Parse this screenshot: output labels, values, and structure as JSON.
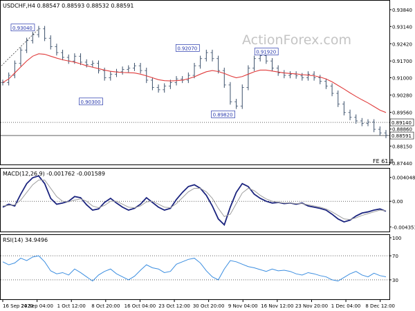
{
  "chart_data": {
    "type": "line",
    "watermark": "ActionForex.com",
    "price_panel": {
      "title": "USDCHF,H4  0.88547 0.88593 0.88532 0.88591",
      "y_ticks": [
        "0.93840",
        "0.93140",
        "0.92420",
        "0.91700",
        "0.91000",
        "0.90280",
        "0.89560",
        "0.88860",
        "0.88150",
        "0.87440"
      ],
      "ylim": [
        0.8744,
        0.9384
      ],
      "hlines": [
        {
          "value": 0.8914,
          "label": "0.89140",
          "style": "dotted"
        },
        {
          "value": 0.88591,
          "label": "0.88591",
          "style": "solid"
        }
      ],
      "annotations": [
        {
          "text": "0.93040",
          "x": "22 Sep",
          "y": 0.9304
        },
        {
          "text": "0.90300",
          "x": "16 Oct",
          "y": 0.903
        },
        {
          "text": "0.92070",
          "x": "30 Oct",
          "y": 0.9207
        },
        {
          "text": "0.89820",
          "x": "6 Nov",
          "y": 0.8982
        },
        {
          "text": "0.91920",
          "x": "10 Nov",
          "y": 0.9192
        }
      ],
      "fe_label": "FE 61.8",
      "series": [
        {
          "name": "Price",
          "color": "#3a4f6a",
          "style": "bars",
          "values": [
            0.908,
            0.911,
            0.916,
            0.9215,
            0.9255,
            0.928,
            0.9304,
            0.9265,
            0.923,
            0.9205,
            0.9185,
            0.917,
            0.919,
            0.9165,
            0.9155,
            0.916,
            0.913,
            0.91,
            0.9115,
            0.9125,
            0.9135,
            0.914,
            0.915,
            0.913,
            0.909,
            0.906,
            0.905,
            0.9065,
            0.908,
            0.9095,
            0.909,
            0.911,
            0.915,
            0.918,
            0.9205,
            0.918,
            0.913,
            0.907,
            0.9,
            0.8982,
            0.906,
            0.914,
            0.918,
            0.9192,
            0.917,
            0.914,
            0.912,
            0.911,
            0.9115,
            0.9108,
            0.91,
            0.9115,
            0.91,
            0.9085,
            0.9065,
            0.9035,
            0.899,
            0.8955,
            0.8935,
            0.892,
            0.891,
            0.8915,
            0.8885,
            0.887,
            0.886
          ]
        },
        {
          "name": "MA",
          "color": "#e03a3a",
          "style": "line",
          "values": [
            0.908,
            0.9095,
            0.912,
            0.9145,
            0.917,
            0.919,
            0.92,
            0.9198,
            0.919,
            0.9182,
            0.9175,
            0.917,
            0.9165,
            0.9158,
            0.915,
            0.9144,
            0.9138,
            0.9132,
            0.9127,
            0.9124,
            0.9122,
            0.9121,
            0.912,
            0.9115,
            0.9108,
            0.91,
            0.9092,
            0.9088,
            0.9087,
            0.9088,
            0.909,
            0.9096,
            0.9104,
            0.9115,
            0.9125,
            0.913,
            0.9126,
            0.9118,
            0.9108,
            0.91,
            0.9105,
            0.9115,
            0.9125,
            0.9132,
            0.9132,
            0.9128,
            0.9124,
            0.912,
            0.9118,
            0.9116,
            0.9113,
            0.9111,
            0.9108,
            0.9103,
            0.9095,
            0.9083,
            0.9068,
            0.9053,
            0.9037,
            0.9022,
            0.9008,
            0.8995,
            0.898,
            0.8965,
            0.8955
          ]
        }
      ]
    },
    "macd_panel": {
      "title": "MACD(12,26,9) -0.001762 -0.001589",
      "y_ticks": [
        "0.004048",
        "0.00",
        "-0.004351"
      ],
      "ylim": [
        -0.0049,
        0.0046
      ],
      "series": [
        {
          "name": "MACD",
          "color": "#1a237e",
          "style": "line",
          "values": [
            -0.001,
            -0.0005,
            -0.0008,
            0.0012,
            0.003,
            0.004,
            0.0043,
            0.003,
            0.0005,
            -0.0005,
            -0.0003,
            0.0,
            0.0008,
            0.0006,
            -0.0006,
            -0.0015,
            -0.0013,
            -0.0002,
            0.0005,
            -0.0003,
            -0.001,
            -0.0015,
            -0.0012,
            -0.0005,
            0.0006,
            -0.0002,
            -0.001,
            -0.0015,
            -0.0012,
            0.0003,
            0.0015,
            0.0025,
            0.0028,
            0.0022,
            0.001,
            -0.0008,
            -0.003,
            -0.004,
            -0.001,
            0.0015,
            0.003,
            0.0025,
            0.0012,
            0.0005,
            0.0,
            -0.0003,
            -0.0002,
            -0.0004,
            -0.0003,
            -0.0005,
            -0.0003,
            -0.0008,
            -0.001,
            -0.0012,
            -0.0015,
            -0.0022,
            -0.003,
            -0.0035,
            -0.0032,
            -0.0025,
            -0.002,
            -0.0018,
            -0.0015,
            -0.0013,
            -0.0017
          ]
        },
        {
          "name": "Signal",
          "color": "#9e9e9e",
          "style": "line",
          "values": [
            -0.0008,
            -0.0007,
            -0.0006,
            0.0002,
            0.0015,
            0.0028,
            0.0036,
            0.0036,
            0.0022,
            0.0008,
            0.0,
            -0.0001,
            0.0002,
            0.0004,
            0.0,
            -0.0008,
            -0.0011,
            -0.0007,
            0.0,
            0.0,
            -0.0005,
            -0.001,
            -0.0011,
            -0.0008,
            -0.0001,
            0.0,
            -0.0005,
            -0.001,
            -0.0011,
            -0.0004,
            0.0006,
            0.0016,
            0.0022,
            0.0022,
            0.0016,
            0.0005,
            -0.0012,
            -0.0026,
            -0.0022,
            -0.0004,
            0.0014,
            0.0022,
            0.0018,
            0.001,
            0.0004,
            0.0,
            -0.0002,
            -0.0003,
            -0.0003,
            -0.0004,
            -0.0004,
            -0.0006,
            -0.0008,
            -0.001,
            -0.0013,
            -0.0018,
            -0.0024,
            -0.003,
            -0.0031,
            -0.0028,
            -0.0024,
            -0.0021,
            -0.0018,
            -0.0015,
            -0.0016
          ]
        }
      ]
    },
    "rsi_panel": {
      "title": "RSI(14) 34.9496",
      "y_ticks": [
        "100",
        "70",
        "30",
        "0"
      ],
      "ylim": [
        0,
        100
      ],
      "levels": [
        70,
        30
      ],
      "series": [
        {
          "name": "RSI",
          "color": "#3a8de0",
          "style": "line",
          "values": [
            60,
            55,
            58,
            66,
            62,
            68,
            70,
            60,
            45,
            40,
            42,
            38,
            48,
            42,
            35,
            28,
            38,
            44,
            48,
            40,
            35,
            30,
            36,
            46,
            55,
            50,
            48,
            42,
            44,
            56,
            60,
            64,
            66,
            58,
            45,
            35,
            30,
            48,
            62,
            60,
            56,
            52,
            50,
            47,
            44,
            48,
            45,
            46,
            44,
            40,
            38,
            42,
            40,
            37,
            35,
            30,
            28,
            34,
            40,
            44,
            38,
            35,
            41,
            37,
            35
          ]
        }
      ]
    },
    "x_tick_labels": [
      "16 Sep 2020",
      "24 Sep 04:00",
      "1 Oct 12:00",
      "8 Oct 20:00",
      "16 Oct 04:00",
      "23 Oct 12:00",
      "30 Oct 20:00",
      "9 Nov 04:00",
      "16 Nov 12:00",
      "23 Nov 20:00",
      "1 Dec 04:00",
      "8 Dec 12:00"
    ]
  }
}
